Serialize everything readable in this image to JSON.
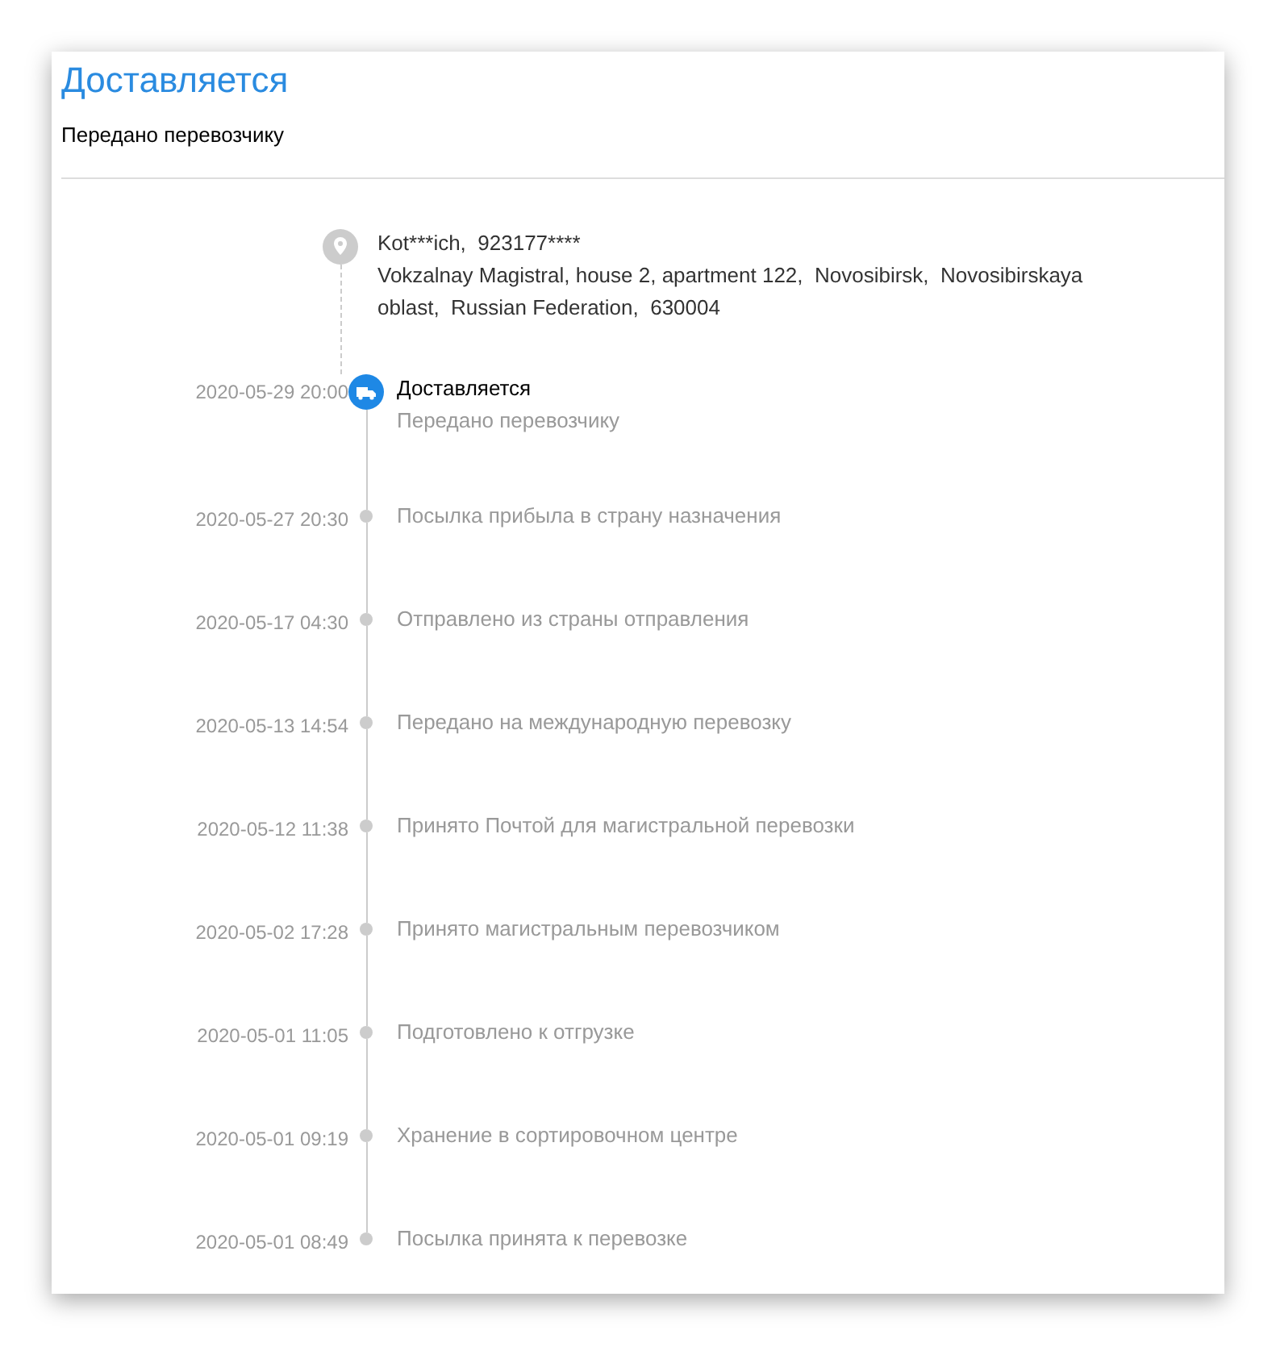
{
  "header": {
    "title": "Доставляется",
    "subtitle": "Передано перевозчику"
  },
  "recipient": {
    "contact": "Kot***ich,  923177****",
    "address": "Vokzalnay Magistral, house 2, apartment 122,  Novosibirsk,  Novosibirskaya oblast,  Russian Federation,  630004"
  },
  "events": [
    {
      "kind": "current",
      "time": "2020-05-29 20:00",
      "title": "Доставляется",
      "subtitle": "Передано перевозчику"
    },
    {
      "kind": "past",
      "time": "2020-05-27 20:30",
      "title": "Посылка прибыла в страну назначения"
    },
    {
      "kind": "past",
      "time": "2020-05-17 04:30",
      "title": "Отправлено из страны отправления"
    },
    {
      "kind": "past",
      "time": "2020-05-13 14:54",
      "title": "Передано на международную перевозку"
    },
    {
      "kind": "past",
      "time": "2020-05-12 11:38",
      "title": "Принято Почтой для магистральной перевозки"
    },
    {
      "kind": "past",
      "time": "2020-05-02 17:28",
      "title": "Принято магистральным перевозчиком"
    },
    {
      "kind": "past",
      "time": "2020-05-01 11:05",
      "title": "Подготовлено к отгрузке"
    },
    {
      "kind": "past",
      "time": "2020-05-01 09:19",
      "title": "Хранение в сортировочном центре"
    },
    {
      "kind": "past",
      "time": "2020-05-01 08:49",
      "title": "Посылка принята к перевозке"
    }
  ]
}
